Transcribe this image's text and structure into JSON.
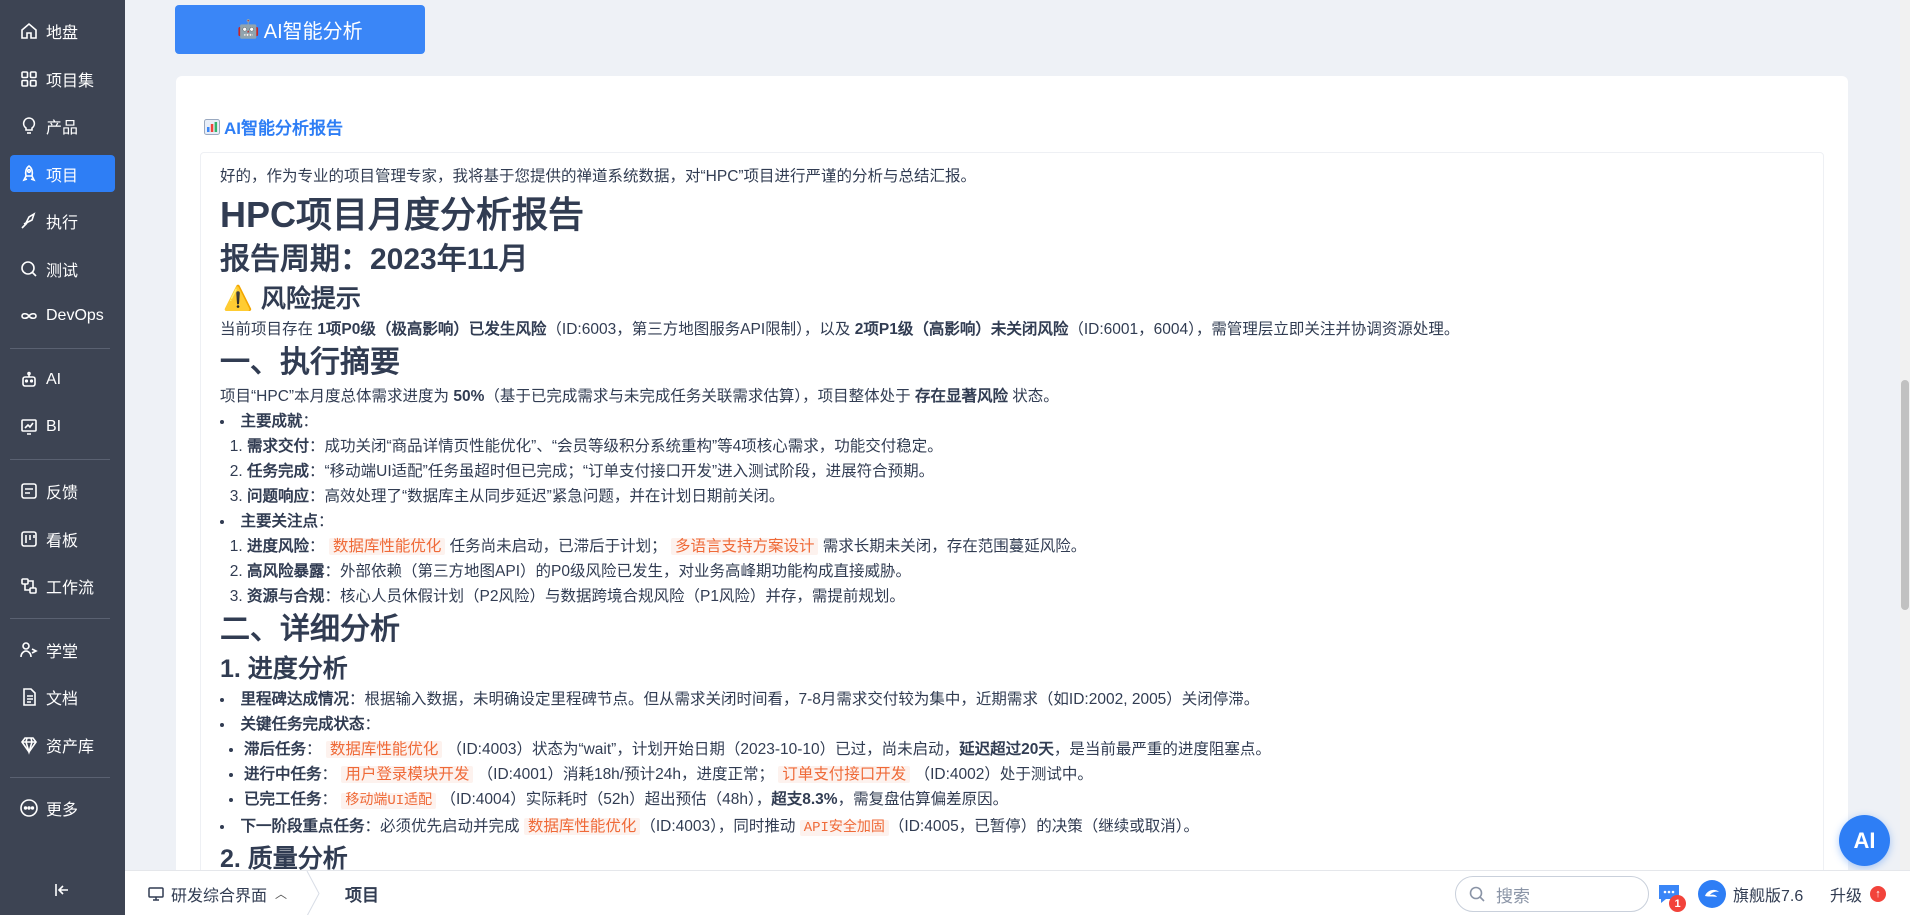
{
  "sidebar": {
    "items": [
      {
        "label": "地盘",
        "icon": "home-icon"
      },
      {
        "label": "项目集",
        "icon": "grid-icon"
      },
      {
        "label": "产品",
        "icon": "bulb-icon"
      },
      {
        "label": "项目",
        "icon": "rocket-icon",
        "active": true
      },
      {
        "label": "执行",
        "icon": "run-icon"
      },
      {
        "label": "测试",
        "icon": "test-icon"
      },
      {
        "label": "DevOps",
        "icon": "infinity-icon"
      },
      {
        "label": "AI",
        "icon": "robot-icon"
      },
      {
        "label": "BI",
        "icon": "chart-icon"
      },
      {
        "label": "反馈",
        "icon": "feedback-icon"
      },
      {
        "label": "看板",
        "icon": "kanban-icon"
      },
      {
        "label": "工作流",
        "icon": "workflow-icon"
      },
      {
        "label": "学堂",
        "icon": "school-icon"
      },
      {
        "label": "文档",
        "icon": "doc-icon"
      },
      {
        "label": "资产库",
        "icon": "diamond-icon"
      },
      {
        "label": "更多",
        "icon": "more-icon"
      }
    ]
  },
  "toolbar": {
    "ai_button_label": "AI智能分析",
    "ai_button_icon": "🤖"
  },
  "report": {
    "heading": "AI智能分析报告",
    "intro": "好的，作为专业的项目管理专家，我将基于您提供的禅道系统数据，对“HPC”项目进行严谨的分析与总结汇报。",
    "title": "HPC项目月度分析报告",
    "period": "报告周期：2023年11月",
    "risk_heading": "风险提示",
    "risk_text_1": "当前项目存在 ",
    "risk_bold_1": "1项P0级（极高影响）已发生风险",
    "risk_text_2": "（ID:6003，第三方地图服务API限制），以及 ",
    "risk_bold_2": "2项P1级（高影响）未关闭风险",
    "risk_text_3": "（ID:6001，6004），需管理层立即关注并协调资源处理。",
    "s1_heading": "一、执行摘要",
    "s1_text_1": "项目“HPC”本月度总体需求进度为 ",
    "s1_bold_1": "50%",
    "s1_text_2": "（基于已完成需求与未完成任务关联需求估算），项目整体处于 ",
    "s1_bold_2": "存在显著风险",
    "s1_text_3": " 状态。",
    "achievements_label": "主要成就",
    "achievements": [
      {
        "bold": "需求交付",
        "text": "：成功关闭“商品详情页性能优化”、“会员等级积分系统重构”等4项核心需求，功能交付稳定。"
      },
      {
        "bold": "任务完成",
        "text": "：“移动端UI适配”任务虽超时但已完成；“订单支付接口开发”进入测试阶段，进展符合预期。"
      },
      {
        "bold": "问题响应",
        "text": "：高效处理了“数据库主从同步延迟”紧急问题，并在计划日期前关闭。"
      }
    ],
    "concerns_label": "主要关注点",
    "concern_1_bold": "进度风险",
    "concern_1_tag_a": "数据库性能优化",
    "concern_1_text_a": " 任务尚未启动，已滞后于计划；",
    "concern_1_tag_b": "多语言支持方案设计",
    "concern_1_text_b": " 需求长期未关闭，存在范围蔓延风险。",
    "concern_2_bold": "高风险暴露",
    "concern_2_text": "：外部依赖（第三方地图API）的P0级风险已发生，对业务高峰期功能构成直接威胁。",
    "concern_3_bold": "资源与合规",
    "concern_3_text": "：核心人员休假计划（P2风险）与数据跨境合规风险（P1风险）并存，需提前规划。",
    "s2_heading": "二、详细分析",
    "s2_1_heading": "1. 进度分析",
    "milestone_bold": "里程碑达成情况",
    "milestone_text": "：根据输入数据，未明确设定里程碑节点。但从需求关闭时间看，7-8月需求交付较为集中，近期需求（如ID:2002, 2005）关闭停滞。",
    "key_tasks_label": "关键任务完成状态",
    "late_bold": "滞后任务",
    "late_tag": "数据库性能优化",
    "late_text_1": "（ID:4003）状态为“wait”，计划开始日期（2023-10-10）已过，尚未启动，",
    "late_bold_2": "延迟超过20天",
    "late_text_2": "，是当前最严重的进度阻塞点。",
    "ongoing_bold": "进行中任务",
    "ongoing_tag_a": "用户登录模块开发",
    "ongoing_text_a": "（ID:4001）消耗18h/预计24h，进度正常；",
    "ongoing_tag_b": "订单支付接口开发",
    "ongoing_text_b": "（ID:4002）处于测试中。",
    "done_bold": "已完工任务",
    "done_tag": "移动端UI适配",
    "done_text_1": "（ID:4004）实际耗时（52h）超出预估（48h），",
    "done_bold_2": "超支8.3%",
    "done_text_2": "，需复盘估算偏差原因。",
    "next_bold": "下一阶段重点任务",
    "next_text_1": "：必须优先启动并完成 ",
    "next_tag_a": "数据库性能优化",
    "next_text_2": "（ID:4003），同时推动 ",
    "next_tag_b": "API安全加固",
    "next_text_3": "（ID:4005，已暂停）的决策（继续或取消）。",
    "s2_2_heading": "2. 质量分析"
  },
  "bottombar": {
    "workspace_label": "研发综合界面",
    "crumb": "项目",
    "search_placeholder": "搜索",
    "message_badge": "1",
    "edition": "旗舰版7.6",
    "upgrade": "升级"
  },
  "ai_float_label": "AI",
  "colors": {
    "accent": "#2e7ef5",
    "sidebar": "#3d4453",
    "tag": "#ef6a38"
  }
}
